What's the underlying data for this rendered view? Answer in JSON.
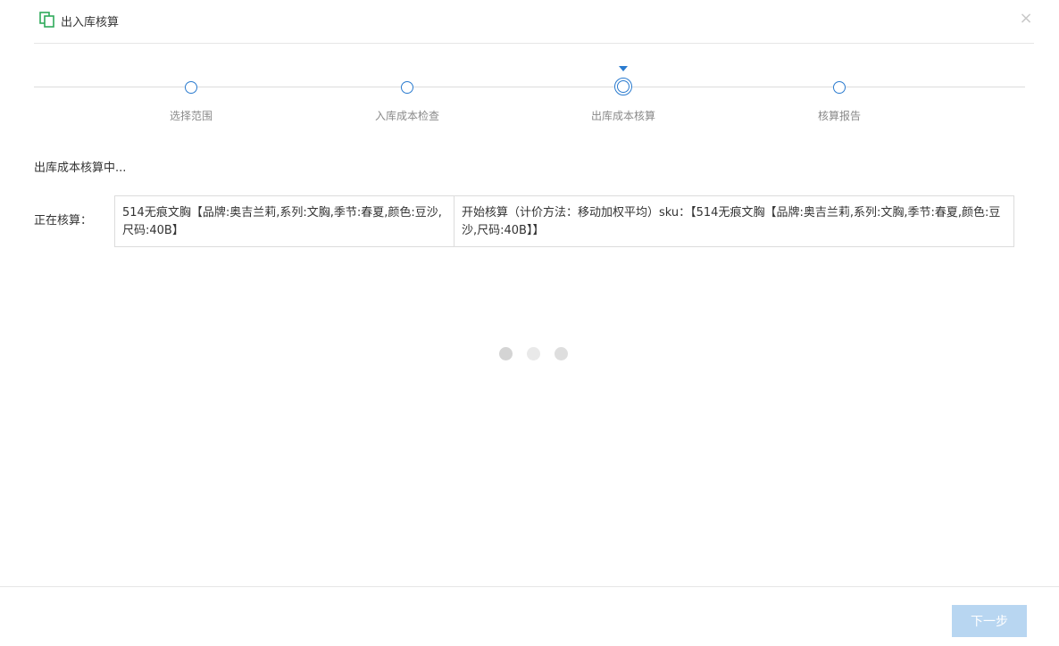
{
  "window": {
    "title": "出入库核算",
    "icon": "copy-window-icon",
    "close_glyph": "×"
  },
  "steps": [
    {
      "label": "选择范围",
      "state": "pending"
    },
    {
      "label": "入库成本检查",
      "state": "pending"
    },
    {
      "label": "出库成本核算",
      "state": "active"
    },
    {
      "label": "核算报告",
      "state": "pending"
    }
  ],
  "status_text": "出库成本核算中...",
  "calculating": {
    "label": "正在核算：",
    "item": "514无痕文胸【品牌:奥吉兰莉,系列:文胸,季节:春夏,颜色:豆沙,尺码:40B】",
    "detail": "开始核算（计价方法：移动加权平均）sku：【514无痕文胸【品牌:奥吉兰莉,系列:文胸,季节:春夏,颜色:豆沙,尺码:40B】】"
  },
  "loader": {
    "dot_colors": [
      "#d4d4d4",
      "#e9e9e9",
      "#dedede"
    ]
  },
  "footer": {
    "next_label": "下一步",
    "next_enabled": false
  },
  "colors": {
    "accent": "#2a7bcf",
    "title_icon": "#2eaa5a",
    "disabled_button": "#b8d6f1"
  }
}
